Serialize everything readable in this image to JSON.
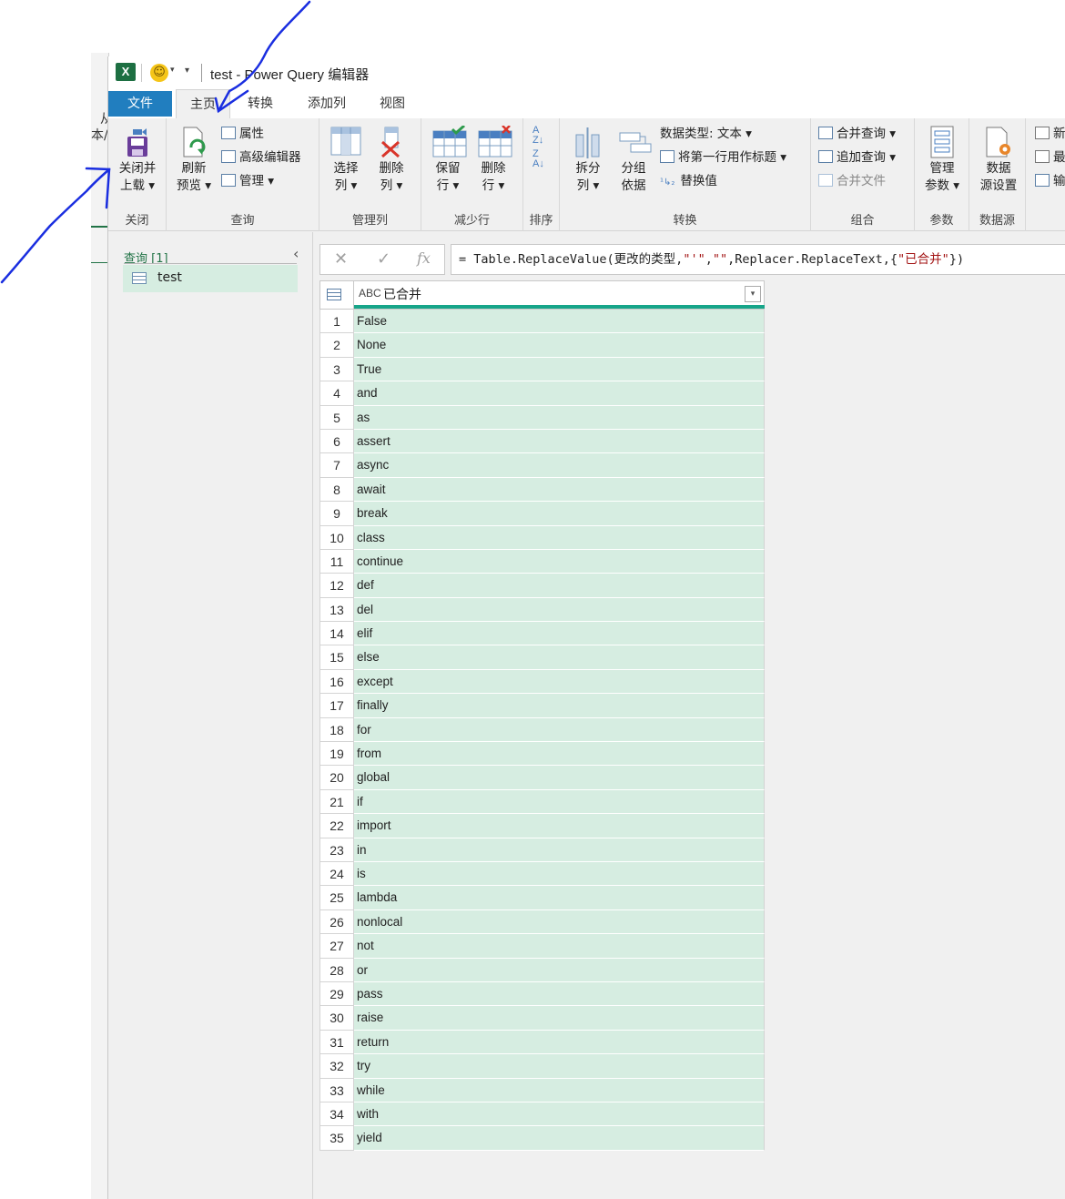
{
  "background_app": {
    "text1": "从",
    "text2": "本/"
  },
  "window": {
    "title": "test - Power Query 编辑器",
    "app_icon": "excel-icon",
    "quick_access": "smiley-icon"
  },
  "tabs": [
    "文件",
    "主页",
    "转换",
    "添加列",
    "视图"
  ],
  "ribbon": {
    "close": {
      "btn": [
        "关闭并",
        "上载 ▾"
      ],
      "group": "关闭"
    },
    "query": {
      "refresh": [
        "刷新",
        "预览 ▾"
      ],
      "properties": "属性",
      "advanced_editor": "高级编辑器",
      "manage": "管理 ▾",
      "group": "查询"
    },
    "manage_columns": {
      "choose": [
        "选择",
        "列 ▾"
      ],
      "remove": [
        "删除",
        "列 ▾"
      ],
      "group": "管理列"
    },
    "reduce_rows": {
      "keep": [
        "保留",
        "行 ▾"
      ],
      "remove": [
        "删除",
        "行 ▾"
      ],
      "group": "减少行"
    },
    "sort": {
      "group": "排序"
    },
    "transform": {
      "split": [
        "拆分",
        "列 ▾"
      ],
      "group_by": [
        "分组",
        "依据"
      ],
      "data_type": "数据类型: 文本 ▾",
      "first_row_header": "将第一行用作标题 ▾",
      "replace_values": "替换值",
      "group": "转换"
    },
    "combine": {
      "merge": "合并查询 ▾",
      "append": "追加查询 ▾",
      "combine_files": "合并文件",
      "group": "组合"
    },
    "parameters": {
      "manage": [
        "管理",
        "参数 ▾"
      ],
      "group": "参数"
    },
    "data_sources": {
      "settings": [
        "数据",
        "源设置"
      ],
      "group": "数据源"
    },
    "new_source": {
      "new": "新",
      "recent": "最",
      "enter": "输"
    }
  },
  "queries_pane": {
    "header": "查询 [1]",
    "items": [
      "test"
    ]
  },
  "formula_bar": {
    "cancel": "✕",
    "confirm": "✓",
    "fx": "fx",
    "formula_parts": [
      "= Table.ReplaceValue(更改的类型,",
      "\"'\"",
      ",",
      "\"\"",
      ",Replacer.ReplaceText,{",
      "\"已合并\"",
      "})"
    ]
  },
  "grid": {
    "type_label": "ABC",
    "column": "已合并",
    "rows": [
      "False",
      "None",
      "True",
      "and",
      "as",
      "assert",
      "async",
      "await",
      "break",
      "class",
      "continue",
      "def",
      "del",
      "elif",
      "else",
      "except",
      "finally",
      "for",
      "from",
      "global",
      "if",
      "import",
      "in",
      "is",
      "lambda",
      "nonlocal",
      "not",
      "or",
      "pass",
      "raise",
      "return",
      "try",
      "while",
      "with",
      "yield"
    ]
  },
  "colors": {
    "accent": "#217ebf",
    "excel_green": "#217346",
    "row_fill": "#d6ede1",
    "header_bar": "#17a589",
    "annotation": "#1a2ee0"
  }
}
